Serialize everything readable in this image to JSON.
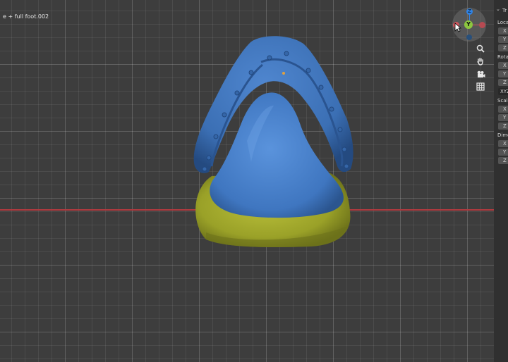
{
  "viewport": {
    "object_label": "e + full foot.002",
    "colors": {
      "background": "#3d3d3d",
      "x_axis": "#b13a3f",
      "object_blue": "#3e74bd",
      "object_yellow": "#a4ab2e"
    }
  },
  "gizmo": {
    "z_label": "Z",
    "y_label": "Y",
    "icons": [
      "z-axis-icon",
      "y-axis-icon",
      "x-axis-icon",
      "cursor-icon"
    ]
  },
  "nav_buttons": [
    "zoom-icon",
    "hand-pan-icon",
    "camera-icon",
    "grid-icon"
  ],
  "sidebar": {
    "panel_title": "Tr",
    "location_label": "Locat",
    "location_fields": [
      "X",
      "Y",
      "Z"
    ],
    "rotation_label": "Rotat",
    "rotation_fields": [
      "X",
      "Y",
      "Z"
    ],
    "rotation_mode": "XYZ",
    "scale_label": "Scale",
    "scale_fields": [
      "X",
      "Y",
      "Z"
    ],
    "dimensions_label": "Dime",
    "dimensions_fields": [
      "X",
      "Y",
      "Z"
    ]
  }
}
